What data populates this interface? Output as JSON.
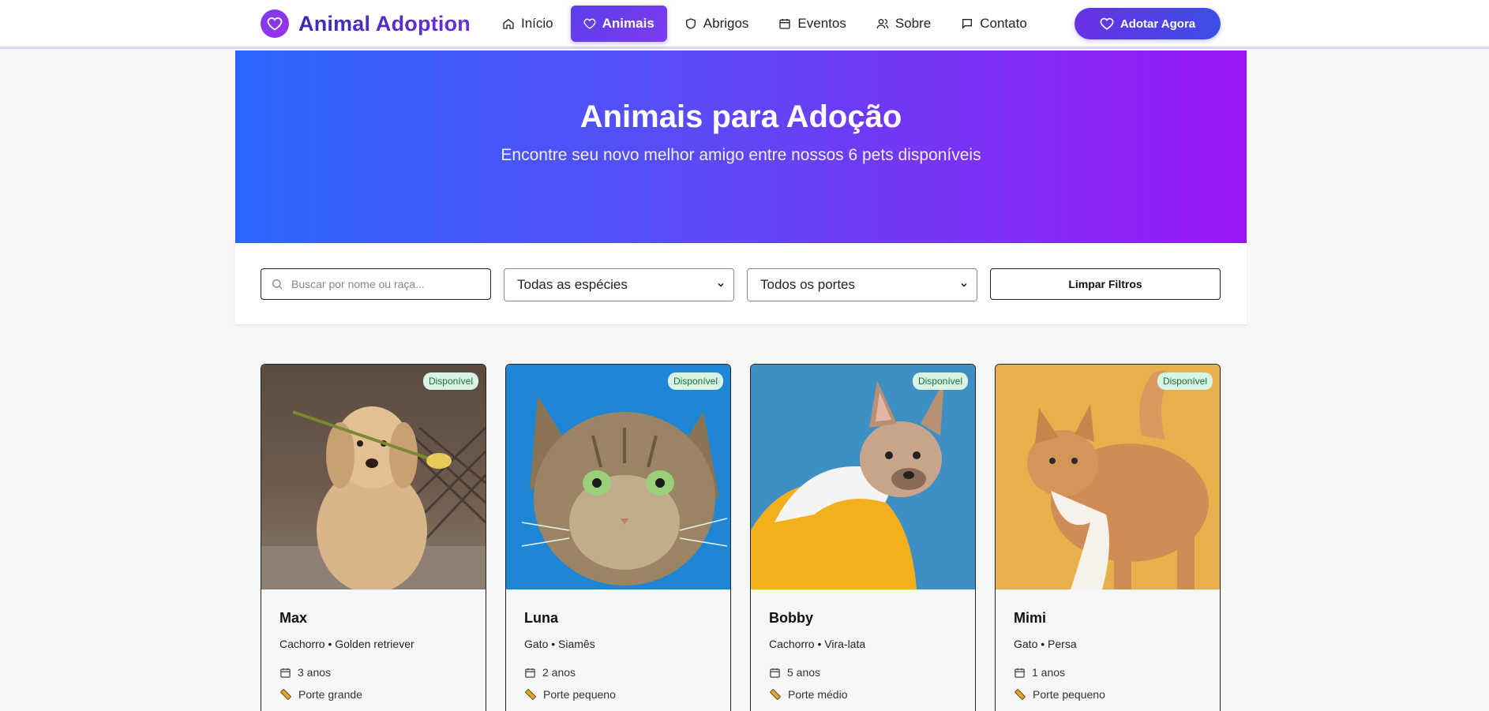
{
  "brand": {
    "name": "Animal Adoption"
  },
  "nav": {
    "items": [
      {
        "label": "Início",
        "icon": "home-icon",
        "active": false
      },
      {
        "label": "Animais",
        "icon": "heart-icon",
        "active": true
      },
      {
        "label": "Abrigos",
        "icon": "shield-icon",
        "active": false
      },
      {
        "label": "Eventos",
        "icon": "calendar-icon",
        "active": false
      },
      {
        "label": "Sobre",
        "icon": "users-icon",
        "active": false
      },
      {
        "label": "Contato",
        "icon": "message-icon",
        "active": false
      }
    ],
    "cta_label": "Adotar Agora"
  },
  "hero": {
    "title": "Animais para Adoção",
    "subtitle": "Encontre seu novo melhor amigo entre nossos 6 pets disponíveis"
  },
  "filters": {
    "search_placeholder": "Buscar por nome ou raça...",
    "species_selected": "Todas as espécies",
    "size_selected": "Todos os portes",
    "clear_label": "Limpar Filtros"
  },
  "pets": [
    {
      "name": "Max",
      "species_breed": "Cachorro • Golden retriever",
      "age": "3 anos",
      "size": "Porte grande",
      "status": "Disponível",
      "photo": "golden-retriever-photo"
    },
    {
      "name": "Luna",
      "species_breed": "Gato • Siamês",
      "age": "2 anos",
      "size": "Porte pequeno",
      "status": "Disponível",
      "photo": "tabby-cat-photo"
    },
    {
      "name": "Bobby",
      "species_breed": "Cachorro • Vira-lata",
      "age": "5 anos",
      "size": "Porte médio",
      "status": "Disponível",
      "photo": "french-bulldog-photo"
    },
    {
      "name": "Mimi",
      "species_breed": "Gato • Persa",
      "age": "1 anos",
      "size": "Porte pequeno",
      "status": "Disponível",
      "photo": "orange-cat-photo"
    }
  ],
  "colors": {
    "accent": "#6a30e6",
    "hero_start": "#2a66ff",
    "hero_end": "#9a16f6",
    "badge_bg": "#d8f5e3"
  }
}
